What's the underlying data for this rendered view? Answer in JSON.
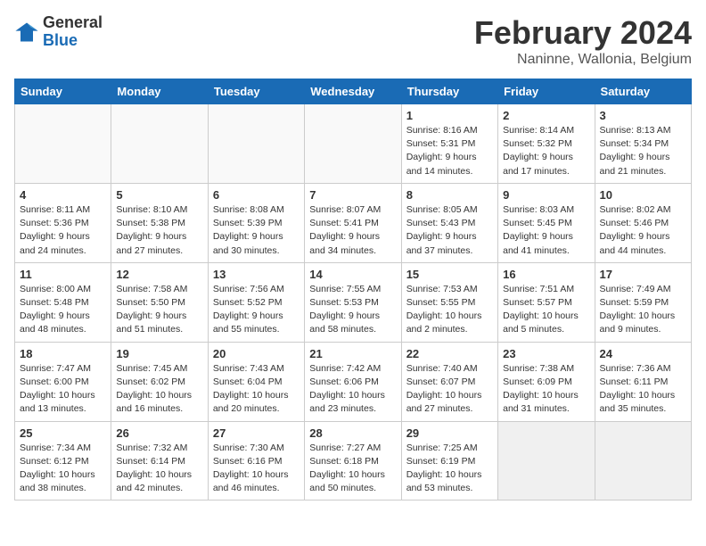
{
  "header": {
    "logo_line1": "General",
    "logo_line2": "Blue",
    "month_year": "February 2024",
    "location": "Naninne, Wallonia, Belgium"
  },
  "days_of_week": [
    "Sunday",
    "Monday",
    "Tuesday",
    "Wednesday",
    "Thursday",
    "Friday",
    "Saturday"
  ],
  "weeks": [
    [
      {
        "day": "",
        "info": ""
      },
      {
        "day": "",
        "info": ""
      },
      {
        "day": "",
        "info": ""
      },
      {
        "day": "",
        "info": ""
      },
      {
        "day": "1",
        "info": "Sunrise: 8:16 AM\nSunset: 5:31 PM\nDaylight: 9 hours\nand 14 minutes."
      },
      {
        "day": "2",
        "info": "Sunrise: 8:14 AM\nSunset: 5:32 PM\nDaylight: 9 hours\nand 17 minutes."
      },
      {
        "day": "3",
        "info": "Sunrise: 8:13 AM\nSunset: 5:34 PM\nDaylight: 9 hours\nand 21 minutes."
      }
    ],
    [
      {
        "day": "4",
        "info": "Sunrise: 8:11 AM\nSunset: 5:36 PM\nDaylight: 9 hours\nand 24 minutes."
      },
      {
        "day": "5",
        "info": "Sunrise: 8:10 AM\nSunset: 5:38 PM\nDaylight: 9 hours\nand 27 minutes."
      },
      {
        "day": "6",
        "info": "Sunrise: 8:08 AM\nSunset: 5:39 PM\nDaylight: 9 hours\nand 30 minutes."
      },
      {
        "day": "7",
        "info": "Sunrise: 8:07 AM\nSunset: 5:41 PM\nDaylight: 9 hours\nand 34 minutes."
      },
      {
        "day": "8",
        "info": "Sunrise: 8:05 AM\nSunset: 5:43 PM\nDaylight: 9 hours\nand 37 minutes."
      },
      {
        "day": "9",
        "info": "Sunrise: 8:03 AM\nSunset: 5:45 PM\nDaylight: 9 hours\nand 41 minutes."
      },
      {
        "day": "10",
        "info": "Sunrise: 8:02 AM\nSunset: 5:46 PM\nDaylight: 9 hours\nand 44 minutes."
      }
    ],
    [
      {
        "day": "11",
        "info": "Sunrise: 8:00 AM\nSunset: 5:48 PM\nDaylight: 9 hours\nand 48 minutes."
      },
      {
        "day": "12",
        "info": "Sunrise: 7:58 AM\nSunset: 5:50 PM\nDaylight: 9 hours\nand 51 minutes."
      },
      {
        "day": "13",
        "info": "Sunrise: 7:56 AM\nSunset: 5:52 PM\nDaylight: 9 hours\nand 55 minutes."
      },
      {
        "day": "14",
        "info": "Sunrise: 7:55 AM\nSunset: 5:53 PM\nDaylight: 9 hours\nand 58 minutes."
      },
      {
        "day": "15",
        "info": "Sunrise: 7:53 AM\nSunset: 5:55 PM\nDaylight: 10 hours\nand 2 minutes."
      },
      {
        "day": "16",
        "info": "Sunrise: 7:51 AM\nSunset: 5:57 PM\nDaylight: 10 hours\nand 5 minutes."
      },
      {
        "day": "17",
        "info": "Sunrise: 7:49 AM\nSunset: 5:59 PM\nDaylight: 10 hours\nand 9 minutes."
      }
    ],
    [
      {
        "day": "18",
        "info": "Sunrise: 7:47 AM\nSunset: 6:00 PM\nDaylight: 10 hours\nand 13 minutes."
      },
      {
        "day": "19",
        "info": "Sunrise: 7:45 AM\nSunset: 6:02 PM\nDaylight: 10 hours\nand 16 minutes."
      },
      {
        "day": "20",
        "info": "Sunrise: 7:43 AM\nSunset: 6:04 PM\nDaylight: 10 hours\nand 20 minutes."
      },
      {
        "day": "21",
        "info": "Sunrise: 7:42 AM\nSunset: 6:06 PM\nDaylight: 10 hours\nand 23 minutes."
      },
      {
        "day": "22",
        "info": "Sunrise: 7:40 AM\nSunset: 6:07 PM\nDaylight: 10 hours\nand 27 minutes."
      },
      {
        "day": "23",
        "info": "Sunrise: 7:38 AM\nSunset: 6:09 PM\nDaylight: 10 hours\nand 31 minutes."
      },
      {
        "day": "24",
        "info": "Sunrise: 7:36 AM\nSunset: 6:11 PM\nDaylight: 10 hours\nand 35 minutes."
      }
    ],
    [
      {
        "day": "25",
        "info": "Sunrise: 7:34 AM\nSunset: 6:12 PM\nDaylight: 10 hours\nand 38 minutes."
      },
      {
        "day": "26",
        "info": "Sunrise: 7:32 AM\nSunset: 6:14 PM\nDaylight: 10 hours\nand 42 minutes."
      },
      {
        "day": "27",
        "info": "Sunrise: 7:30 AM\nSunset: 6:16 PM\nDaylight: 10 hours\nand 46 minutes."
      },
      {
        "day": "28",
        "info": "Sunrise: 7:27 AM\nSunset: 6:18 PM\nDaylight: 10 hours\nand 50 minutes."
      },
      {
        "day": "29",
        "info": "Sunrise: 7:25 AM\nSunset: 6:19 PM\nDaylight: 10 hours\nand 53 minutes."
      },
      {
        "day": "",
        "info": ""
      },
      {
        "day": "",
        "info": ""
      }
    ]
  ]
}
